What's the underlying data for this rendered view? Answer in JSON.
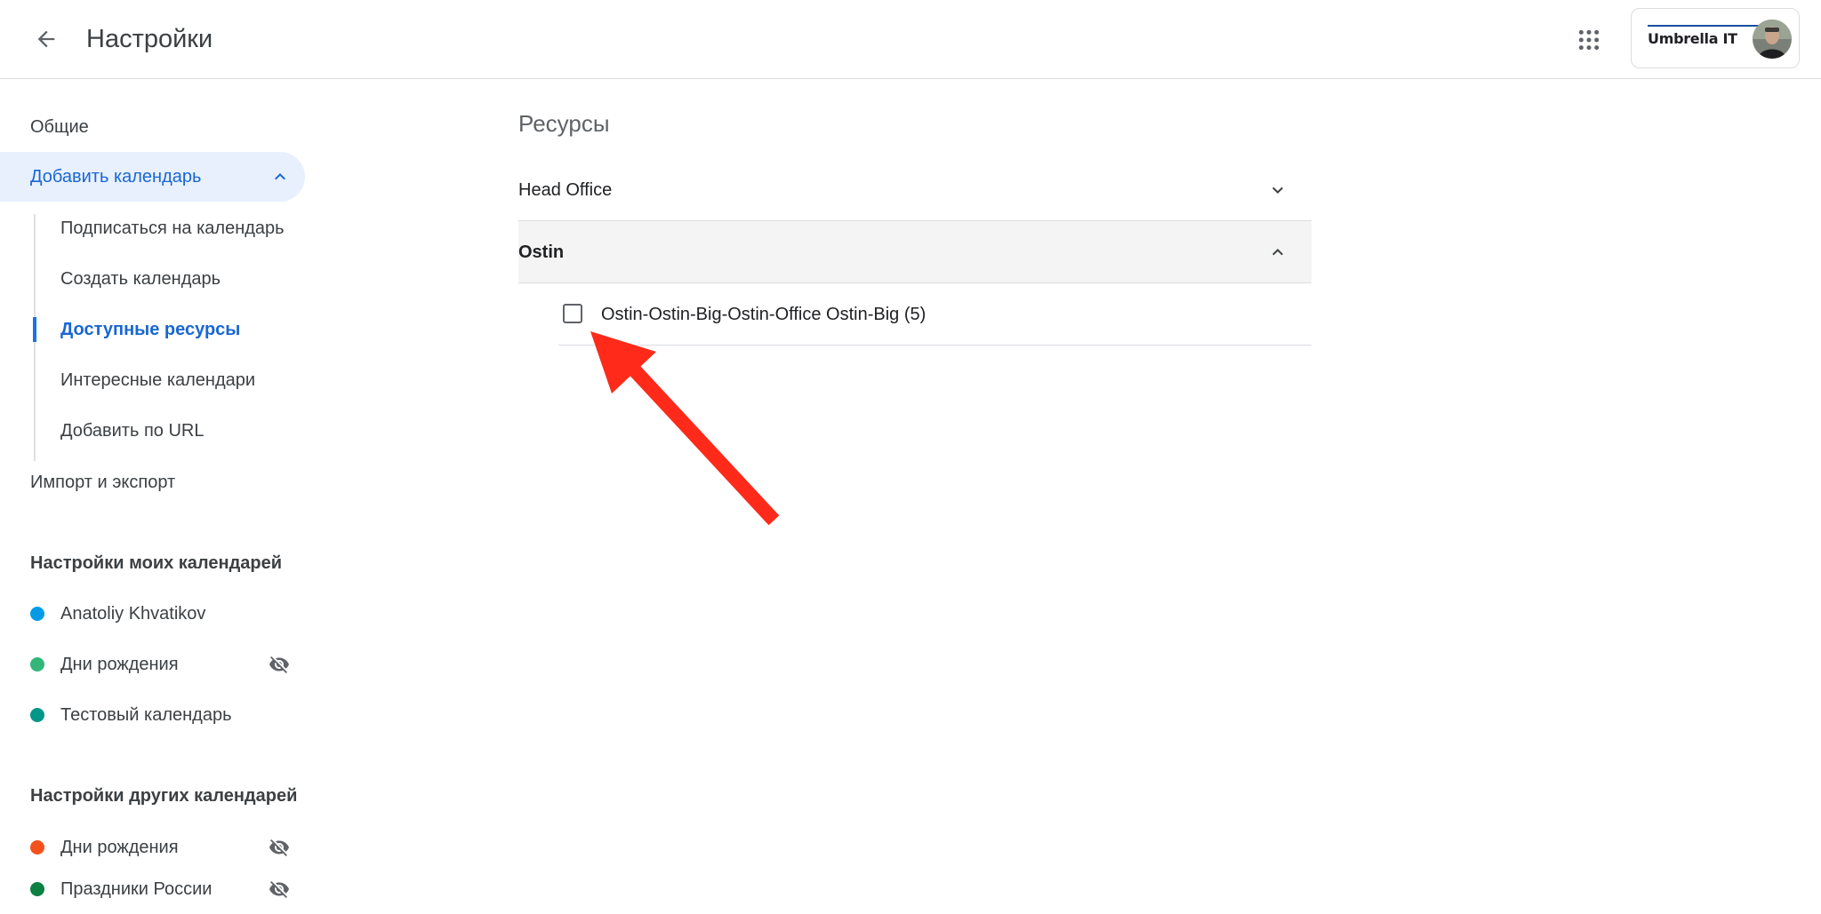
{
  "header": {
    "title": "Настройки",
    "org_logo_text": "Umbrella IT"
  },
  "sidebar": {
    "general": "Общие",
    "add_calendar": "Добавить календарь",
    "sub_items": [
      "Подписаться на календарь",
      "Создать календарь",
      "Доступные ресурсы",
      "Интересные календари",
      "Добавить по URL"
    ],
    "active_sub_item": "Доступные ресурсы",
    "import_export": "Импорт и экспорт",
    "my_calendars_heading": "Настройки моих календарей",
    "my_calendars": [
      {
        "label": "Anatoliy Khvatikov",
        "color": "#039be5",
        "hidden": false
      },
      {
        "label": "Дни рождения",
        "color": "#33b679",
        "hidden": true
      },
      {
        "label": "Тестовый календарь",
        "color": "#009688",
        "hidden": false
      }
    ],
    "other_calendars_heading": "Настройки других календарей",
    "other_calendars": [
      {
        "label": "Дни рождения",
        "color": "#f4511e",
        "hidden": true
      },
      {
        "label": "Праздники России",
        "color": "#0b8043",
        "hidden": true
      }
    ]
  },
  "main": {
    "section_title": "Ресурсы",
    "groups": [
      {
        "label": "Head Office",
        "expanded": false
      },
      {
        "label": "Ostin",
        "expanded": true
      }
    ],
    "resources": [
      {
        "label": "Ostin-Ostin-Big-Ostin-Office Ostin-Big (5)",
        "checked": false
      }
    ]
  },
  "colors": {
    "accent": "#1a73e8",
    "active_bg": "#e8f0fe",
    "annotation_arrow": "#ff2a1a"
  }
}
